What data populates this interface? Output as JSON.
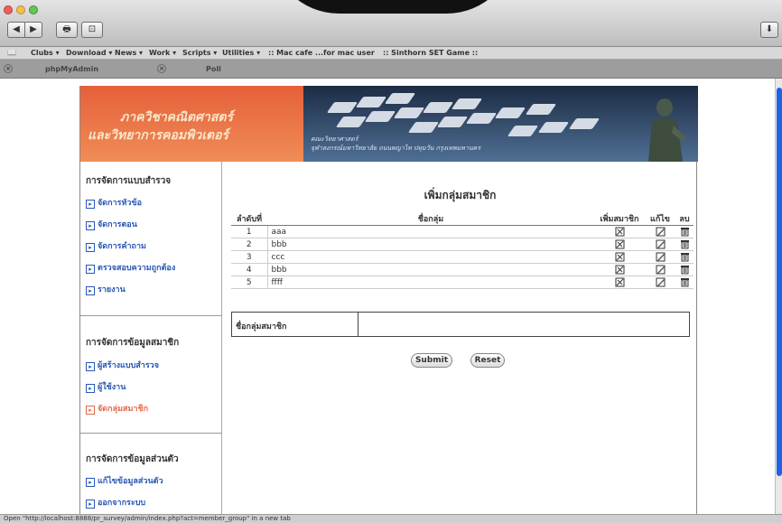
{
  "toolbar": {
    "back": "◀",
    "forward": "▶",
    "print": "🖶",
    "screenshot": "⊡",
    "download": "⬇"
  },
  "bookmarks": [
    {
      "label": "Clubs ▾"
    },
    {
      "label": "Download ▾"
    },
    {
      "label": "News ▾"
    },
    {
      "label": "Work ▾"
    },
    {
      "label": "Scripts ▾"
    },
    {
      "label": "Utilities ▾"
    },
    {
      "label": ":: Mac cafe ...for mac user"
    },
    {
      "label": ":: Sinthorn SET Game ::"
    }
  ],
  "tabs": [
    {
      "label": "phpMyAdmin"
    },
    {
      "label": "Poll"
    }
  ],
  "banner": {
    "title_line1": "ภาควิชาคณิตศาสตร์",
    "title_line2": "และวิทยาการคอมพิวเตอร์",
    "caption_line1": "คณะวิทยาศาสตร์",
    "caption_line2": "จุฬาลงกรณ์มหาวิทยาลัย ถนนพญาไท ปทุมวัน กรุงเทพมหานคร"
  },
  "sidebar": {
    "sections": [
      {
        "heading": "การจัดการแบบสำรวจ",
        "items": [
          {
            "label": "จัดการหัวข้อ"
          },
          {
            "label": "จัดการตอน"
          },
          {
            "label": "จัดการคำถาม"
          },
          {
            "label": "ตรวจสอบความถูกต้อง"
          },
          {
            "label": "รายงาน"
          }
        ]
      },
      {
        "heading": "การจัดการข้อมูลสมาชิก",
        "items": [
          {
            "label": "ผู้สร้างแบบสำรวจ"
          },
          {
            "label": "ผู้ใช้งาน"
          },
          {
            "label": "จัดกลุ่มสมาชิก",
            "active": true
          }
        ]
      },
      {
        "heading": "การจัดการข้อมูลส่วนตัว",
        "items": [
          {
            "label": "แก้ไขข้อมูลส่วนตัว"
          },
          {
            "label": "ออกจากระบบ"
          }
        ]
      }
    ]
  },
  "main": {
    "title": "เพิ่มกลุ่มสมาชิก",
    "table": {
      "headers": [
        "ลำดับที่",
        "ชื่อกลุ่ม",
        "เพิ่มสมาชิก",
        "แก้ไข",
        "ลบ"
      ],
      "rows": [
        {
          "no": "1",
          "name": "aaa"
        },
        {
          "no": "2",
          "name": "bbb"
        },
        {
          "no": "3",
          "name": "ccc"
        },
        {
          "no": "4",
          "name": "bbb"
        },
        {
          "no": "5",
          "name": "ffff"
        }
      ]
    },
    "form": {
      "label": "ชื่อกลุ่มสมาชิก",
      "value": "",
      "submit": "Submit",
      "reset": "Reset"
    }
  },
  "status": "Open \"http://localhost:8888/pr_survey/admin/index.php?act=member_group\" in a new tab",
  "icons": {
    "add_member": "add-member-icon",
    "edit": "edit-icon",
    "delete": "trash-icon"
  }
}
